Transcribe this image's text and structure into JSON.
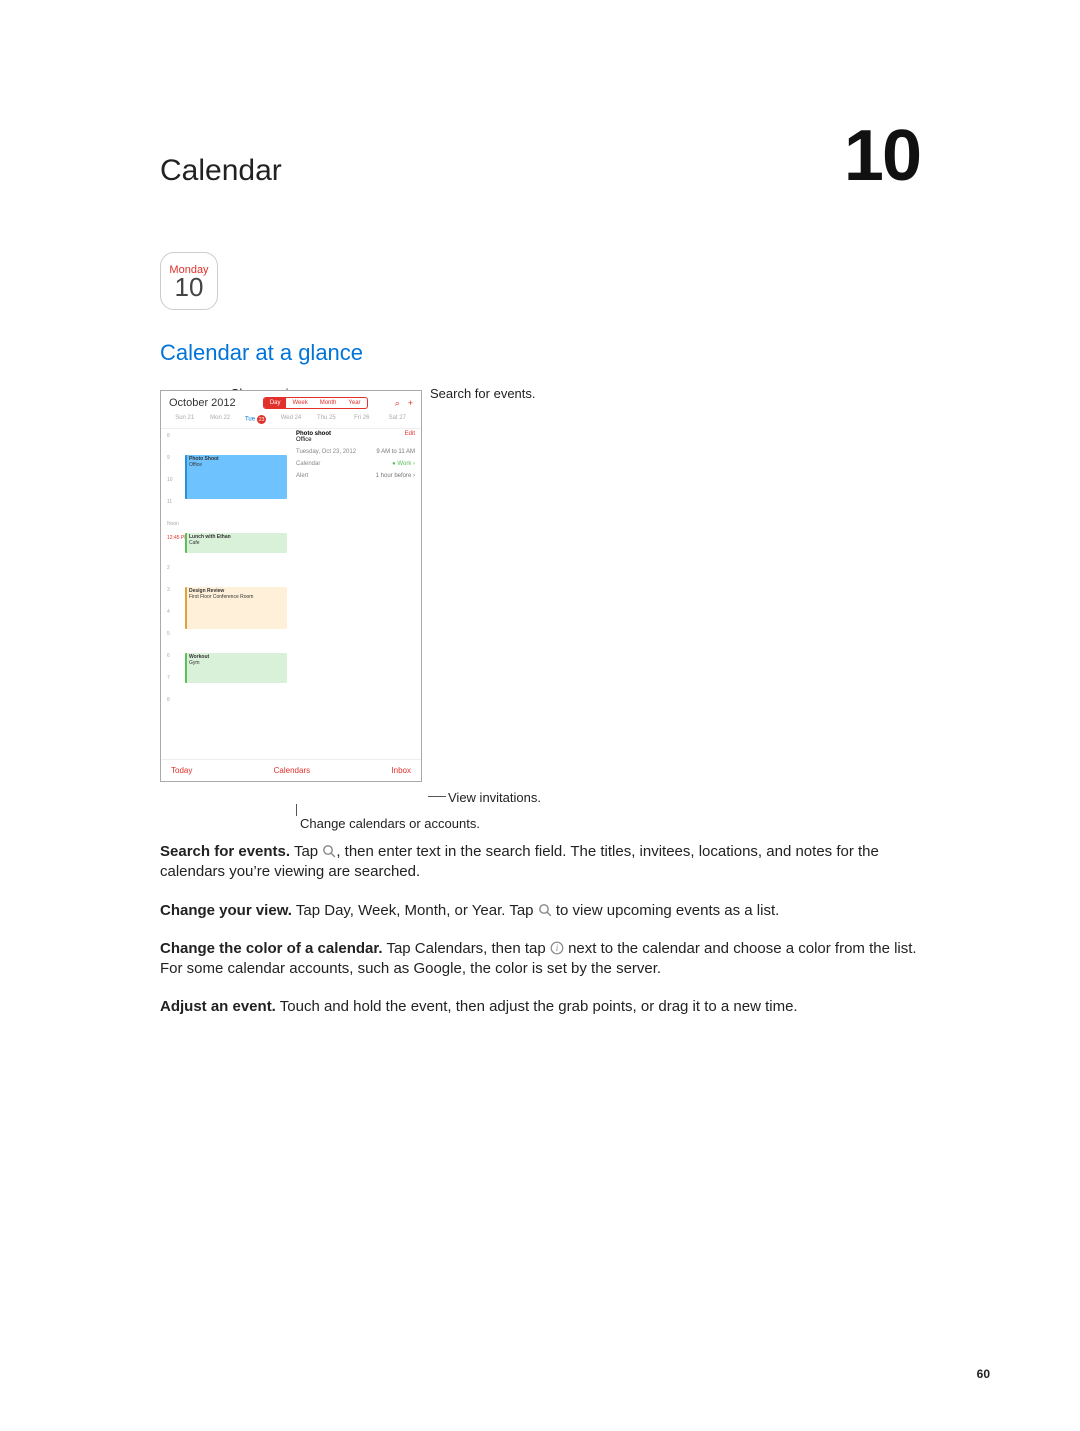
{
  "chapter": {
    "title": "Calendar",
    "number": "10"
  },
  "app_tile": {
    "weekday": "Monday",
    "day": "10"
  },
  "section": {
    "title": "Calendar at a glance"
  },
  "callouts": {
    "change_views": "Change views.",
    "search_events": "Search for events.",
    "view_invitations": "View invitations.",
    "change_calendars": "Change calendars or accounts."
  },
  "device": {
    "month_label": "October 2012",
    "segments": {
      "day": "Day",
      "week": "Week",
      "month": "Month",
      "year": "Year"
    },
    "search_glyph": "⌕",
    "plus_glyph": "+",
    "days": {
      "sun": "Sun 21",
      "mon": "Mon 22",
      "tue_label": "Tue",
      "tue_num": "23",
      "wed": "Wed 24",
      "thu": "Thu 25",
      "fri": "Fri 26",
      "sat": "Sat 27"
    },
    "hours": {
      "h8": "8",
      "h9": "9",
      "h10": "10",
      "h11": "11",
      "noon": "Noon",
      "now": "12:45 PM",
      "h2": "2",
      "h3": "3",
      "h4": "4",
      "h5": "5",
      "h6": "6",
      "h7": "7",
      "h8b": "8"
    },
    "events": {
      "e1": {
        "title": "Photo Shoot",
        "loc": "Office"
      },
      "e2": {
        "title": "Lunch with Ethan",
        "loc": "Cafe"
      },
      "e3": {
        "title": "Design Review",
        "loc": "First Floor Conference Room"
      },
      "e4": {
        "title": "Workout",
        "loc": "Gym"
      }
    },
    "detail": {
      "title": "Photo shoot",
      "loc": "Office",
      "edit": "Edit",
      "date_l": "Tuesday, Oct 23, 2012",
      "date_r": "9 AM to 11 AM",
      "cal_l": "Calendar",
      "cal_r": "● Work  ›",
      "alert_l": "Alert",
      "alert_r": "1 hour before  ›"
    },
    "bottom": {
      "today": "Today",
      "calendars": "Calendars",
      "inbox": "Inbox"
    }
  },
  "body": {
    "p1a": "Search for events.",
    "p1b": " Tap ",
    "p1c": ", then enter text in the search field. The titles, invitees, locations, and notes for the calendars you’re viewing are searched.",
    "p2a": "Change your view.",
    "p2b": " Tap Day, Week, Month, or Year. Tap ",
    "p2c": " to view upcoming events as a list.",
    "p3a": "Change the color of a calendar.",
    "p3b": " Tap Calendars, then tap ",
    "p3c": " next to the calendar and choose a color from the list. For some calendar accounts, such as Google, the color is set by the server.",
    "p4a": "Adjust an event.",
    "p4b": " Touch and hold the event, then adjust the grab points, or drag it to a new time."
  },
  "page_number": "60"
}
